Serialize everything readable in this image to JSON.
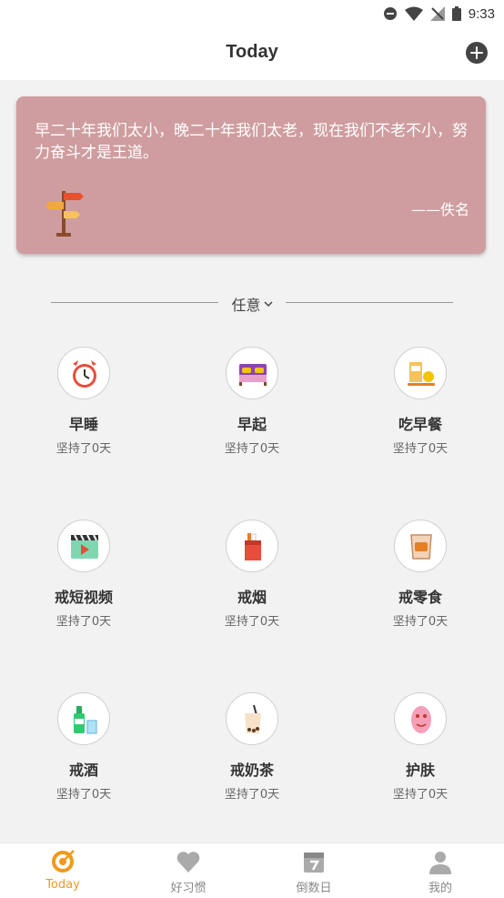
{
  "status_bar": {
    "time": "9:33"
  },
  "header": {
    "title": "Today"
  },
  "quote": {
    "text": "早二十年我们太小，晚二十年我们太老，现在我们不老不小，努力奋斗才是王道。",
    "author": "——佚名"
  },
  "filter": {
    "label": "任意"
  },
  "habits": [
    {
      "name": "早睡",
      "stat": "坚持了0天",
      "icon": "alarm-clock-icon"
    },
    {
      "name": "早起",
      "stat": "坚持了0天",
      "icon": "bed-icon"
    },
    {
      "name": "吃早餐",
      "stat": "坚持了0天",
      "icon": "breakfast-icon"
    },
    {
      "name": "戒短视频",
      "stat": "坚持了0天",
      "icon": "video-clapper-icon"
    },
    {
      "name": "戒烟",
      "stat": "坚持了0天",
      "icon": "cigarette-pack-icon"
    },
    {
      "name": "戒零食",
      "stat": "坚持了0天",
      "icon": "snack-bag-icon"
    },
    {
      "name": "戒酒",
      "stat": "坚持了0天",
      "icon": "liquor-bottle-icon"
    },
    {
      "name": "戒奶茶",
      "stat": "坚持了0天",
      "icon": "milk-tea-icon"
    },
    {
      "name": "护肤",
      "stat": "坚持了0天",
      "icon": "face-mask-icon"
    }
  ],
  "tabs": [
    {
      "label": "Today",
      "icon": "target-icon",
      "active": true
    },
    {
      "label": "好习惯",
      "icon": "heart-icon",
      "active": false
    },
    {
      "label": "倒数日",
      "icon": "calendar-icon",
      "active": false
    },
    {
      "label": "我的",
      "icon": "person-icon",
      "active": false
    }
  ],
  "colors": {
    "accent": "#f09a1c",
    "quote_card": "#cf9d9f",
    "background": "#f2f2f2"
  }
}
